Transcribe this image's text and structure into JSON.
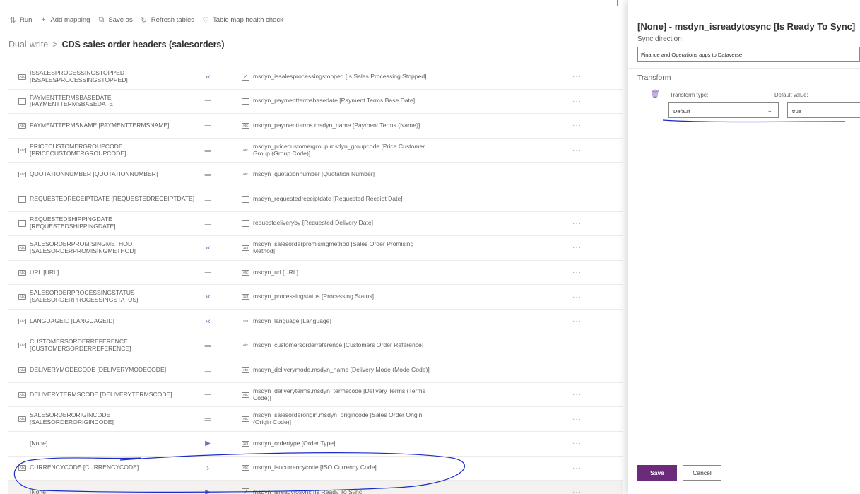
{
  "toolbar": {
    "items": [
      {
        "icon": "sort-icon",
        "glyph": "⇅",
        "label": "Run"
      },
      {
        "icon": "plus-icon",
        "glyph": "+",
        "label": "Add mapping"
      },
      {
        "icon": "save-as-icon",
        "glyph": "⧉",
        "label": "Save as"
      },
      {
        "icon": "refresh-icon",
        "glyph": "↻",
        "label": "Refresh tables"
      },
      {
        "icon": "heart-icon",
        "glyph": "♡",
        "label": "Table map health check"
      }
    ]
  },
  "breadcrumb": {
    "root": "Dual-write",
    "separator": ">",
    "current": "CDS sales order headers (salesorders)"
  },
  "rows": [
    {
      "src_icon": "Abc",
      "src": "ISSALESPROCESSINGSTOPPED [ISSALESPROCESSINGSTOPPED]",
      "map": "bi",
      "dst_icon": "chk",
      "dst": "msdyn_issalesprocessingstopped [Is Sales Processing Stopped]",
      "more": "···"
    },
    {
      "src_icon": "cal",
      "src": "PAYMENTTERMSBASEDATE [PAYMENTTERMSBASEDATE]",
      "map": "eq",
      "dst_icon": "cal",
      "dst": "msdyn_paymenttermsbasedate [Payment Terms Base Date]",
      "more": "···"
    },
    {
      "src_icon": "Abc",
      "src": "PAYMENTTERMSNAME [PAYMENTTERMSNAME]",
      "map": "eq",
      "dst_icon": "Abc",
      "dst": "msdyn_paymentterms.msdyn_name [Payment Terms (Name)]",
      "more": "···"
    },
    {
      "src_icon": "Abc",
      "src": "PRICECUSTOMERGROUPCODE [PRICECUSTOMERGROUPCODE]",
      "map": "eq",
      "dst_icon": "Abc",
      "dst": "msdyn_pricecustomergroup.msdyn_groupcode [Price Customer Group (Group Code)]",
      "more": "···"
    },
    {
      "src_icon": "Abc",
      "src": "QUOTATIONNUMBER [QUOTATIONNUMBER]",
      "map": "eq",
      "dst_icon": "Abc",
      "dst": "msdyn_quotationnumber [Quotation Number]",
      "more": "···"
    },
    {
      "src_icon": "cal",
      "src": "REQUESTEDRECEIPTDATE [REQUESTEDRECEIPTDATE]",
      "map": "eq",
      "dst_icon": "cal",
      "dst": "msdyn_requestedreceiptdate [Requested Receipt Date]",
      "more": "···"
    },
    {
      "src_icon": "cal",
      "src": "REQUESTEDSHIPPINGDATE [REQUESTEDSHIPPINGDATE]",
      "map": "eq",
      "dst_icon": "cal",
      "dst": "requestdeliveryby [Requested Delivery Date]",
      "more": "···"
    },
    {
      "src_icon": "Abc",
      "src": "SALESORDERPROMISINGMETHOD [SALESORDERPROMISINGMETHOD]",
      "map": "bi",
      "dst_icon": "123",
      "dst": "msdyn_salesorderpromisingmethod [Sales Order Promising Method]",
      "more": "···"
    },
    {
      "src_icon": "Abc",
      "src": "URL [URL]",
      "map": "eq",
      "dst_icon": "Abc",
      "dst": "msdyn_url [URL]",
      "more": "···"
    },
    {
      "src_icon": "Abc",
      "src": "SALESORDERPROCESSINGSTATUS [SALESORDERPROCESSINGSTATUS]",
      "map": "bi",
      "dst_icon": "123",
      "dst": "msdyn_processingstatus [Processing Status]",
      "more": "···"
    },
    {
      "src_icon": "Abc",
      "src": "LANGUAGEID [LANGUAGEID]",
      "map": "bi",
      "dst_icon": "123",
      "dst": "msdyn_language [Language]",
      "more": "···"
    },
    {
      "src_icon": "Abc",
      "src": "CUSTOMERSORDERREFERENCE [CUSTOMERSORDERREFERENCE]",
      "map": "eq",
      "dst_icon": "Abc",
      "dst": "msdyn_customersorderreference [Customers Order Reference]",
      "more": "···"
    },
    {
      "src_icon": "Abc",
      "src": "DELIVERYMODECODE [DELIVERYMODECODE]",
      "map": "eq",
      "dst_icon": "Abc",
      "dst": "msdyn_deliverymode.msdyn_name [Delivery Mode (Mode Code)]",
      "more": "···"
    },
    {
      "src_icon": "Abc",
      "src": "DELIVERYTERMSCODE [DELIVERYTERMSCODE]",
      "map": "eq",
      "dst_icon": "Abc",
      "dst": "msdyn_deliveryterms.msdyn_termscode [Delivery Terms (Terms Code)]",
      "more": "···"
    },
    {
      "src_icon": "Abc",
      "src": "SALESORDERORIGINCODE [SALESORDERORIGINCODE]",
      "map": "eq",
      "dst_icon": "Abc",
      "dst": "msdyn_salesorderorigin.msdyn_origincode [Sales Order Origin (Origin Code)]",
      "more": "···"
    },
    {
      "src_icon": "blank",
      "src": "[None]",
      "map": "play",
      "dst_icon": "123",
      "dst": "msdyn_ordertype [Order Type]",
      "more": "···"
    },
    {
      "src_icon": "Abc",
      "src": "CURRENCYCODE [CURRENCYCODE]",
      "map": "gt",
      "dst_icon": "Abc",
      "dst": "msdyn_isocurrencycode [ISO Currency Code]",
      "more": "···"
    },
    {
      "src_icon": "blank",
      "src": "[None]",
      "map": "play",
      "dst_icon": "chk",
      "dst": "msdyn_isreadytosync [Is Ready To Sync]",
      "more": "···",
      "selected": true
    }
  ],
  "map_glyphs": {
    "eq": "═",
    "bi": "›‹",
    "gt": "›",
    "play": "▶"
  },
  "panel": {
    "title": "[None] - msdyn_isreadytosync [Is Ready To Sync]",
    "sync_label": "Sync direction",
    "sync_value": "Finance and Operations apps to Dataverse",
    "transform_heading": "Transform",
    "transform_type_label": "Transform type:",
    "transform_type_value": "Default",
    "default_value_label": "Default value:",
    "default_value": "true",
    "save_label": "Save",
    "cancel_label": "Cancel"
  },
  "colors": {
    "accent": "#6b2a7a",
    "annotation": "#1a2bc9",
    "map_purple": "#8764b8"
  }
}
